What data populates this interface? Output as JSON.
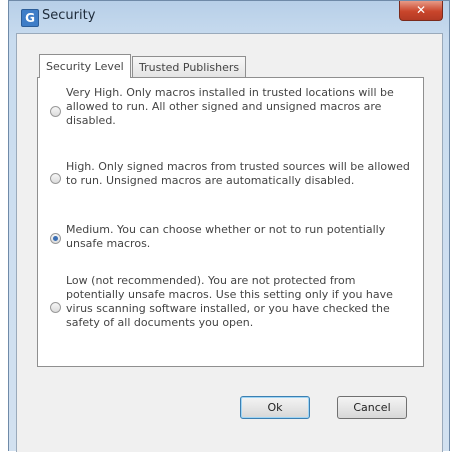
{
  "window": {
    "title": "Security",
    "app_icon_letter": "G",
    "close_symbol": "✕"
  },
  "tabs": [
    {
      "label": "Security Level",
      "active": true
    },
    {
      "label": "Trusted Publishers",
      "active": false
    }
  ],
  "options": [
    {
      "text": "Very High. Only macros installed in trusted locations will be allowed to run. All other signed and unsigned macros are disabled.",
      "selected": false
    },
    {
      "text": "High. Only signed macros from trusted sources will be allowed to run. Unsigned macros are automatically disabled.",
      "selected": false
    },
    {
      "text": "Medium. You can choose whether or not to run potentially unsafe macros.",
      "selected": true
    },
    {
      "text": "Low (not recommended). You are not protected from potentially unsafe macros. Use this setting only if you have virus scanning software installed, or you have checked the safety of all documents you open.",
      "selected": false
    }
  ],
  "buttons": {
    "ok": "Ok",
    "cancel": "Cancel"
  }
}
